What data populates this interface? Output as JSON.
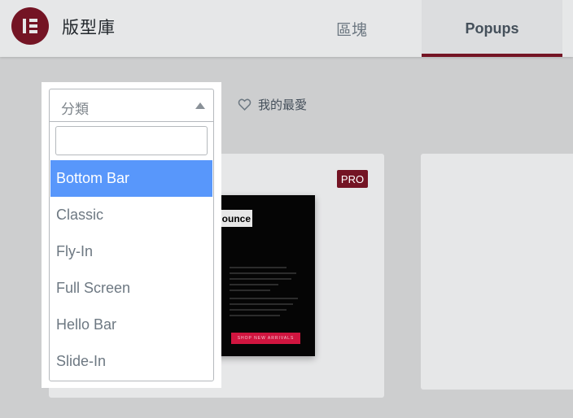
{
  "header": {
    "app_title": "版型庫",
    "tabs": [
      {
        "label": "區塊"
      },
      {
        "label": "Popups"
      }
    ]
  },
  "filter": {
    "category_placeholder": "分類",
    "search_value": "",
    "options": [
      "Bottom Bar",
      "Classic",
      "Fly-In",
      "Full Screen",
      "Hello Bar",
      "Slide-In"
    ],
    "selected": "Bottom Bar"
  },
  "favorites_label": "我的最愛",
  "template_card": {
    "badge": "PRO",
    "preview_heading": "ounce",
    "preview_cta": "SHOP NEW ARRIVALS"
  },
  "colors": {
    "brand": "#741424",
    "selected_option": "#5897fb",
    "header_bg": "#e6e7e8"
  },
  "icons": {
    "logo": "elementor-logo-icon",
    "favorites": "heart-icon",
    "dropdown": "caret-up-icon"
  }
}
